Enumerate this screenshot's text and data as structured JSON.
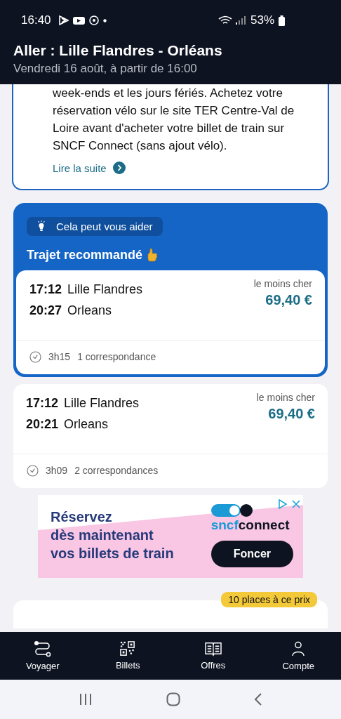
{
  "status_bar": {
    "time": "16:40",
    "battery": "53%"
  },
  "header": {
    "title": "Aller : Lille Flandres - Orléans",
    "subtitle": "Vendredi 16 août, à partir de 16:00"
  },
  "info_card": {
    "text": "week-ends et les jours fériés. Achetez votre réservation vélo sur le site TER Centre-Val de Loire avant d'acheter votre billet de train sur SNCF Connect (sans ajout vélo).",
    "link": "Lire la suite"
  },
  "recommendation": {
    "tag": "Cela peut vous aider",
    "title": "Trajet recommandé"
  },
  "journeys": [
    {
      "recommended": true,
      "departure_time": "17:12",
      "departure_station": "Lille Flandres",
      "arrival_time": "20:27",
      "arrival_station": "Orleans",
      "price_label": "le moins cher",
      "price": "69,40 €",
      "duration": "3h15",
      "connections": "1 correspondance"
    },
    {
      "recommended": false,
      "departure_time": "17:12",
      "departure_station": "Lille Flandres",
      "arrival_time": "20:21",
      "arrival_station": "Orleans",
      "price_label": "le moins cher",
      "price": "69,40 €",
      "duration": "3h09",
      "connections": "2 correspondances"
    }
  ],
  "ad": {
    "headline_lines": [
      "Réservez",
      "dès maintenant",
      "vos billets de train"
    ],
    "brand_prefix": "sncf",
    "brand_suffix": "connect",
    "button": "Foncer"
  },
  "next_card": {
    "badge": "10 places à ce prix"
  },
  "bottom_nav": [
    {
      "kind": "route",
      "label": "Voyager"
    },
    {
      "kind": "qr",
      "label": "Billets"
    },
    {
      "kind": "book",
      "label": "Offres"
    },
    {
      "kind": "person",
      "label": "Compte"
    }
  ]
}
